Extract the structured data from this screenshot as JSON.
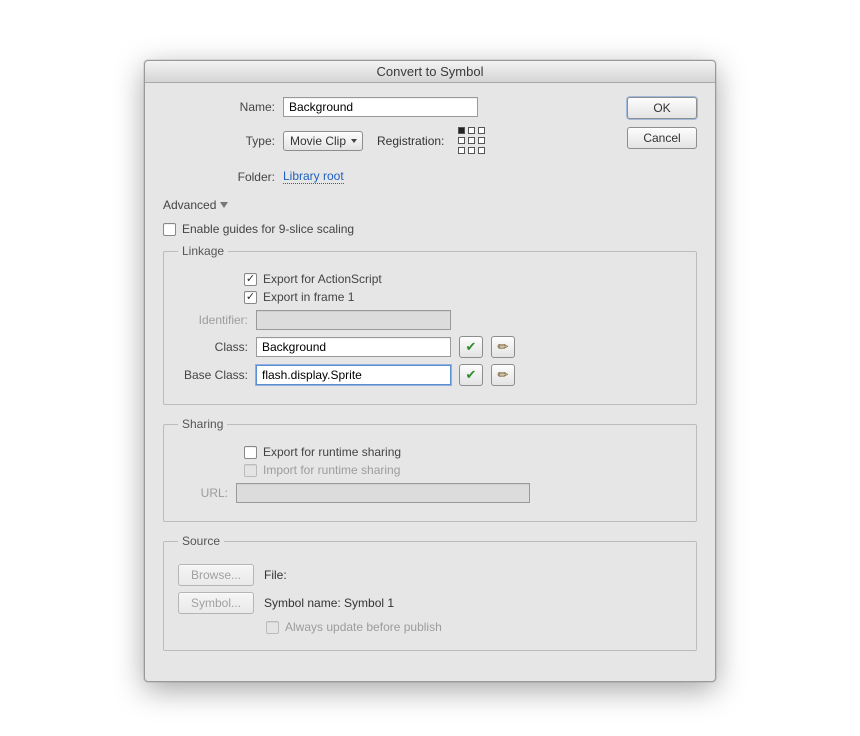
{
  "title": "Convert to Symbol",
  "buttons": {
    "ok": "OK",
    "cancel": "Cancel"
  },
  "name": {
    "label": "Name:",
    "value": "Background"
  },
  "type": {
    "label": "Type:",
    "value": "Movie Clip"
  },
  "registration": {
    "label": "Registration:"
  },
  "folder": {
    "label": "Folder:",
    "link": "Library root"
  },
  "advanced": "Advanced",
  "nineSlice": "Enable guides for 9-slice scaling",
  "linkage": {
    "legend": "Linkage",
    "exportAS": "Export for ActionScript",
    "exportFrame": "Export in frame 1",
    "identifier": {
      "label": "Identifier:",
      "value": ""
    },
    "class": {
      "label": "Class:",
      "value": "Background"
    },
    "baseClass": {
      "label": "Base Class:",
      "value": "flash.display.Sprite"
    }
  },
  "sharing": {
    "legend": "Sharing",
    "exportRuntime": "Export for runtime sharing",
    "importRuntime": "Import for runtime sharing",
    "url": {
      "label": "URL:",
      "value": ""
    }
  },
  "source": {
    "legend": "Source",
    "browse": "Browse...",
    "fileLabel": "File:",
    "symbolBtn": "Symbol...",
    "symbolName": "Symbol name: Symbol 1",
    "alwaysUpdate": "Always update before publish"
  }
}
